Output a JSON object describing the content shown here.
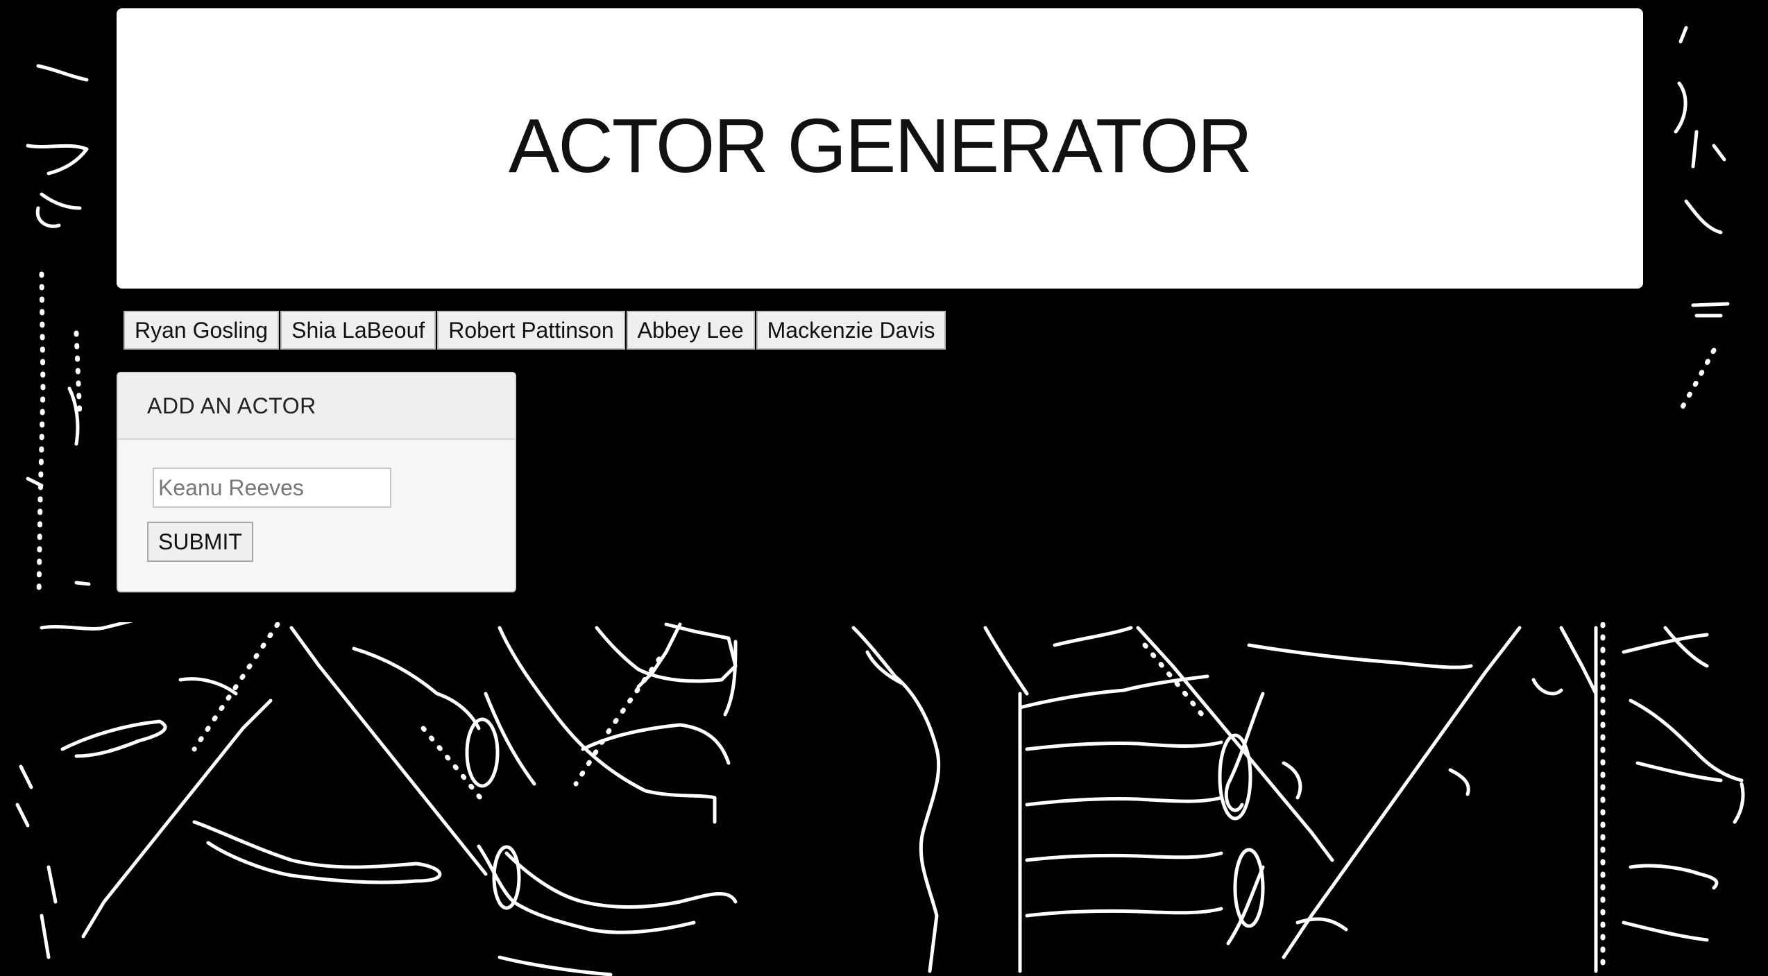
{
  "header": {
    "title": "ACTOR GENERATOR"
  },
  "actor_buttons": [
    {
      "label": "Ryan Gosling"
    },
    {
      "label": "Shia LaBeouf"
    },
    {
      "label": "Robert Pattinson"
    },
    {
      "label": "Abbey Lee"
    },
    {
      "label": "Mackenzie Davis"
    }
  ],
  "add_actor_panel": {
    "title": "ADD AN ACTOR",
    "input_value": "",
    "input_placeholder": "Keanu Reeves",
    "submit_label": "SUBMIT"
  },
  "colors": {
    "background": "#000000",
    "card": "#ffffff",
    "panel": "#f7f7f8",
    "line_art": "#ffffff"
  }
}
